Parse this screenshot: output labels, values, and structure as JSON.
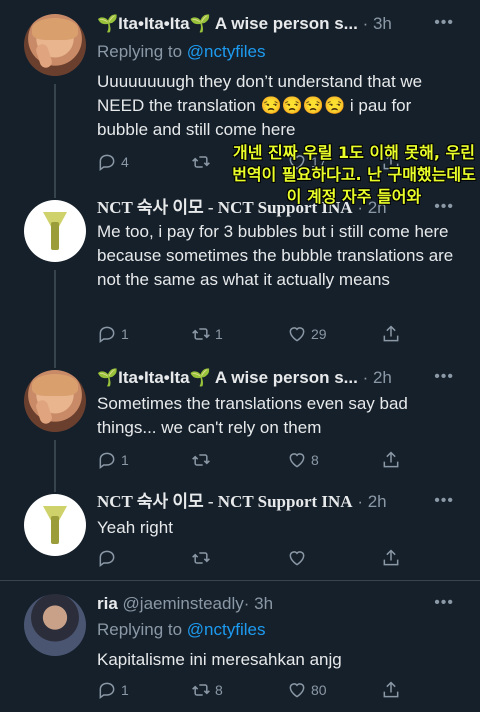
{
  "tweets": [
    {
      "name": "🌱Ita•Ita•Ita🌱 A wise person s...",
      "handle": "",
      "time": "· 3h",
      "reply_prefix": "Replying to",
      "reply_to": "@nctyfiles",
      "text": "Uuuuuuuugh they don’t understand that we NEED the translation 😒😒😒😒 i pau for bubble and still come here",
      "replies": "4",
      "retweets": "",
      "likes": "17"
    },
    {
      "name": "NCT 숙사 이모 - NCT Support INA",
      "handle": "",
      "time": "· 2h",
      "text": "Me too, i pay for 3 bubbles but i still come here because sometimes the bubble translations are not the same as what it actually means",
      "replies": "1",
      "retweets": "1",
      "likes": "29"
    },
    {
      "name": "🌱Ita•Ita•Ita🌱 A wise person s...",
      "handle": "",
      "time": "· 2h",
      "text": "Sometimes the translations even say bad things... we can't rely on them",
      "replies": "1",
      "retweets": "",
      "likes": "8"
    },
    {
      "name": "NCT 숙사 이모 - NCT Support INA",
      "handle": "",
      "time": "· 2h",
      "text": "Yeah right",
      "replies": "",
      "retweets": "",
      "likes": ""
    },
    {
      "name": "ria",
      "handle": "@jaeminsteadly",
      "time": "· 3h",
      "reply_prefix": "Replying to",
      "reply_to": "@nctyfiles",
      "text": "Kapitalisme ini meresahkan anjg",
      "replies": "1",
      "retweets": "8",
      "likes": "80"
    }
  ],
  "overlay_translation": "개넨 진짜 우릴 1도 이해 못해, 우린 번역이 필요하다고. 난 구매했는데도 이 계정 자주 들어와",
  "more_glyph": "•••",
  "colors": {
    "background": "#15202b",
    "text": "#e7e9ea",
    "muted": "#8b98a5",
    "link": "#1d9bf0",
    "divider": "#38444d",
    "overlay_text": "#eaff2a"
  }
}
